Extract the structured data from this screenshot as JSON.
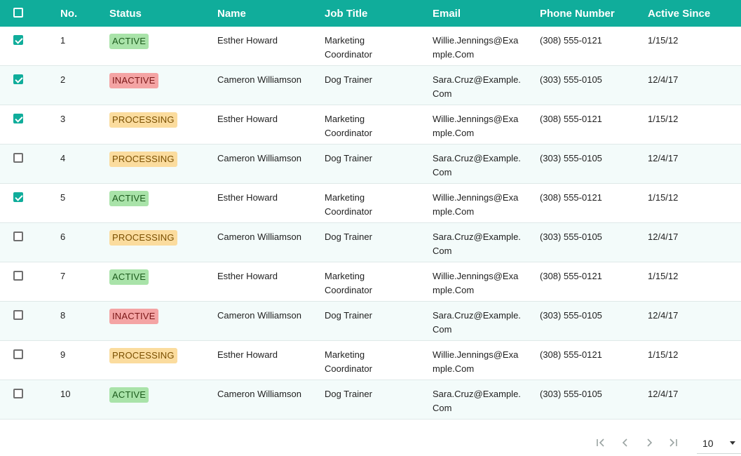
{
  "table": {
    "columns": {
      "no": "No.",
      "status": "Status",
      "name": "Name",
      "job_title": "Job Title",
      "email": "Email",
      "phone": "Phone Number",
      "active_since": "Active Since"
    },
    "select_all_checked": false,
    "rows": [
      {
        "checked": true,
        "no": "1",
        "status": "ACTIVE",
        "name": "Esther Howard",
        "job_l1": "Marketing",
        "job_l2": "Coordinator",
        "email_l1": "Willie.Jennings@Exa",
        "email_l2": "mple.Com",
        "phone": "(308) 555-0121",
        "since": "1/15/12"
      },
      {
        "checked": true,
        "no": "2",
        "status": "INACTIVE",
        "name": "Cameron Williamson",
        "job_l1": "Dog Trainer",
        "job_l2": "",
        "email_l1": "Sara.Cruz@Example.",
        "email_l2": "Com",
        "phone": "(303) 555-0105",
        "since": "12/4/17"
      },
      {
        "checked": true,
        "no": "3",
        "status": "PROCESSING",
        "name": "Esther Howard",
        "job_l1": "Marketing",
        "job_l2": "Coordinator",
        "email_l1": "Willie.Jennings@Exa",
        "email_l2": "mple.Com",
        "phone": "(308) 555-0121",
        "since": "1/15/12"
      },
      {
        "checked": false,
        "no": "4",
        "status": "PROCESSING",
        "name": "Cameron Williamson",
        "job_l1": "Dog Trainer",
        "job_l2": "",
        "email_l1": "Sara.Cruz@Example.",
        "email_l2": "Com",
        "phone": "(303) 555-0105",
        "since": "12/4/17"
      },
      {
        "checked": true,
        "no": "5",
        "status": "ACTIVE",
        "name": "Esther Howard",
        "job_l1": "Marketing",
        "job_l2": "Coordinator",
        "email_l1": "Willie.Jennings@Exa",
        "email_l2": "mple.Com",
        "phone": "(308) 555-0121",
        "since": "1/15/12"
      },
      {
        "checked": false,
        "no": "6",
        "status": "PROCESSING",
        "name": "Cameron Williamson",
        "job_l1": "Dog Trainer",
        "job_l2": "",
        "email_l1": "Sara.Cruz@Example.",
        "email_l2": "Com",
        "phone": "(303) 555-0105",
        "since": "12/4/17"
      },
      {
        "checked": false,
        "no": "7",
        "status": "ACTIVE",
        "name": "Esther Howard",
        "job_l1": "Marketing",
        "job_l2": "Coordinator",
        "email_l1": "Willie.Jennings@Exa",
        "email_l2": "mple.Com",
        "phone": "(308) 555-0121",
        "since": "1/15/12"
      },
      {
        "checked": false,
        "no": "8",
        "status": "INACTIVE",
        "name": "Cameron Williamson",
        "job_l1": "Dog Trainer",
        "job_l2": "",
        "email_l1": "Sara.Cruz@Example.",
        "email_l2": "Com",
        "phone": "(303) 555-0105",
        "since": "12/4/17"
      },
      {
        "checked": false,
        "no": "9",
        "status": "PROCESSING",
        "name": "Esther Howard",
        "job_l1": "Marketing",
        "job_l2": "Coordinator",
        "email_l1": "Willie.Jennings@Exa",
        "email_l2": "mple.Com",
        "phone": "(308) 555-0121",
        "since": "1/15/12"
      },
      {
        "checked": false,
        "no": "10",
        "status": "ACTIVE",
        "name": "Cameron Williamson",
        "job_l1": "Dog Trainer",
        "job_l2": "",
        "email_l1": "Sara.Cruz@Example.",
        "email_l2": "Com",
        "phone": "(303) 555-0105",
        "since": "12/4/17"
      }
    ]
  },
  "pagination": {
    "icons": [
      "first-page-icon",
      "previous-page-icon",
      "next-page-icon",
      "last-page-icon"
    ],
    "rows_per_page": "10"
  },
  "colors": {
    "header_bg": "#10ad9b",
    "active": "#a9e3a9",
    "inactive": "#f4a4a4",
    "processing": "#fbdc9e"
  }
}
